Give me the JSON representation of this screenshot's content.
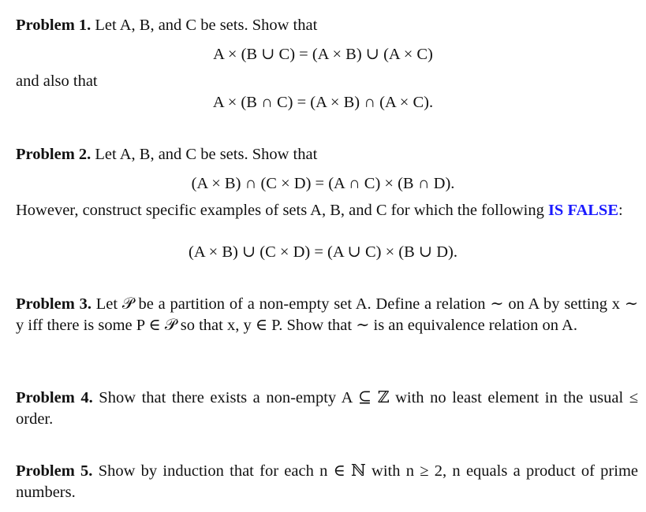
{
  "problems": [
    {
      "label": "Problem 1.",
      "text": "Let A, B, and C be sets. Show that",
      "eq1": "A × (B ∪ C) = (A × B) ∪ (A × C)",
      "mid": "and also that",
      "eq2": "A × (B ∩ C) = (A × B) ∩ (A × C)."
    },
    {
      "label": "Problem 2.",
      "text": "Let A, B, and C be sets. Show that",
      "eq1": "(A × B) ∩ (C × D) = (A ∩ C) × (B ∩ D).",
      "mid": "However, construct specific examples of sets A, B, and C for which the following",
      "highlight": "IS FALSE",
      "after": ":",
      "eq2": "(A × B) ∪ (C × D) = (A ∪ C) × (B ∪ D)."
    },
    {
      "label": "Problem 3.",
      "text": "Let 𝒫 be a partition of a non-empty set A. Define a relation ∼ on A by setting x ∼ y iff there is some P ∈ 𝒫 so that x, y ∈ P. Show that ∼ is an equivalence relation on A."
    },
    {
      "label": "Problem 4.",
      "text": "Show that there exists a non-empty A ⊆ ℤ with no least element in the usual ≤ order."
    },
    {
      "label": "Problem 5.",
      "text": "Show by induction that for each n ∈ ℕ with n ≥ 2, n equals a product of prime numbers."
    }
  ],
  "colors": {
    "highlight": "#1a1aff",
    "text": "#111111"
  }
}
